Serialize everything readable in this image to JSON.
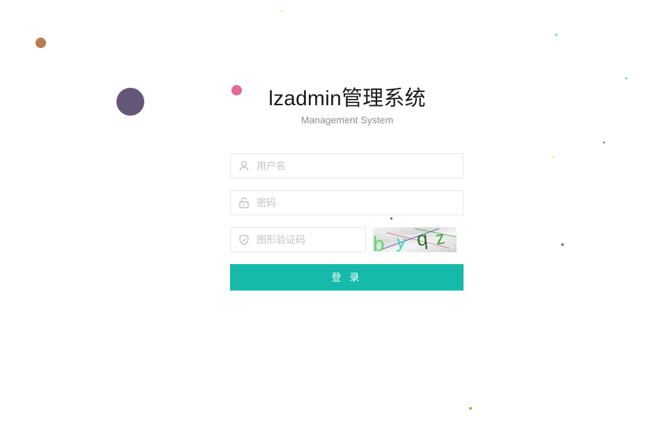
{
  "header": {
    "title": "lzadmin管理系统",
    "subtitle": "Management System"
  },
  "form": {
    "username": {
      "placeholder": "用户名",
      "value": ""
    },
    "password": {
      "placeholder": "密码",
      "value": ""
    },
    "captcha": {
      "placeholder": "图形验证码",
      "value": "",
      "image_text": "byqz"
    },
    "submit_label": "登 录"
  },
  "icons": {
    "username": "user-icon",
    "password": "lock-icon",
    "captcha": "shield-icon"
  },
  "colors": {
    "accent": "#16baaa",
    "border": "#e6e6e6",
    "placeholder": "#c2c2c2",
    "subtitle": "#8c8c8c"
  }
}
